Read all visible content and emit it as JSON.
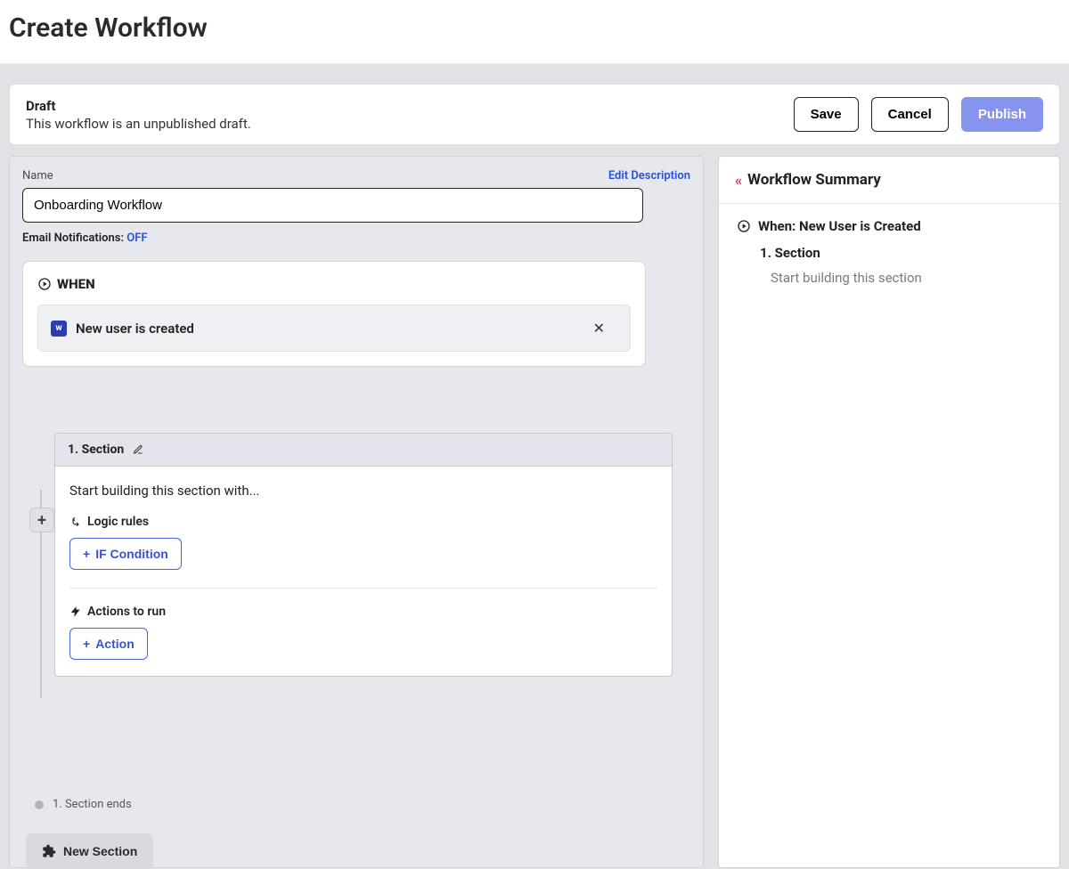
{
  "page": {
    "title": "Create Workflow"
  },
  "status": {
    "title": "Draft",
    "subtitle": "This workflow is an unpublished draft."
  },
  "actions": {
    "save": "Save",
    "cancel": "Cancel",
    "publish": "Publish"
  },
  "editor": {
    "name_label": "Name",
    "edit_description": "Edit Description",
    "name_value": "Onboarding Workflow",
    "email_label": "Email Notifications:",
    "email_value": "OFF",
    "when": {
      "heading": "WHEN",
      "trigger": "New user is created"
    },
    "section": {
      "header": "1.  Section",
      "hint": "Start building this section with...",
      "logic_label": "Logic rules",
      "if_button": "IF Condition",
      "actions_label": "Actions to run",
      "action_button": "Action",
      "ends_label": "1. Section ends"
    },
    "new_section": "New Section"
  },
  "summary": {
    "title": "Workflow Summary",
    "when_line": "When: New User is Created",
    "section_line": "1. Section",
    "section_hint": "Start building this section"
  }
}
